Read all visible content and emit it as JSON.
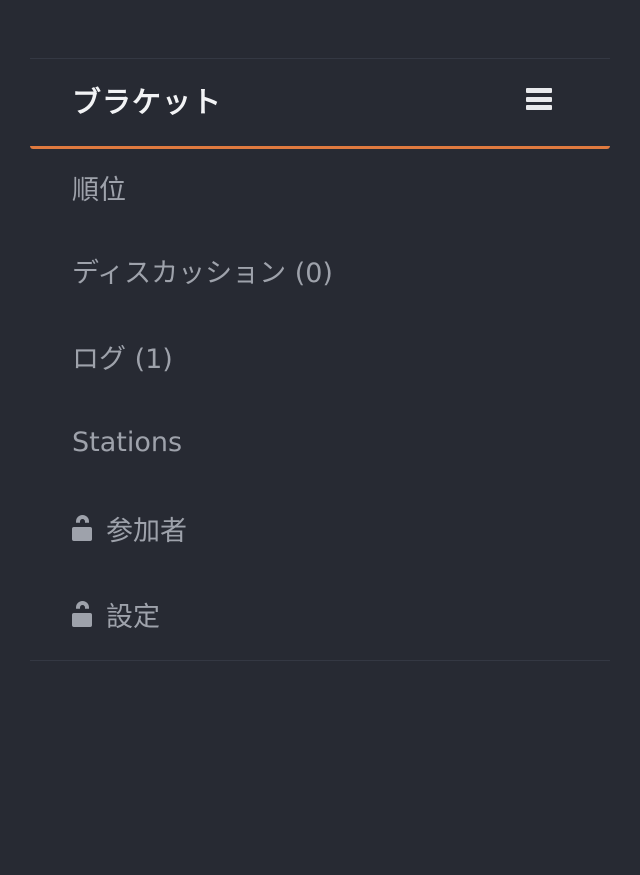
{
  "header": {
    "title": "ブラケット",
    "menu_icon": "hamburger-menu-icon"
  },
  "nav": {
    "items": [
      {
        "label": "順位",
        "locked": false
      },
      {
        "label": "ディスカッション (0)",
        "locked": false
      },
      {
        "label": "ログ (1)",
        "locked": false
      },
      {
        "label": "Stations",
        "locked": false
      },
      {
        "label": "参加者",
        "locked": true,
        "icon": "unlock-icon"
      },
      {
        "label": "設定",
        "locked": true,
        "icon": "unlock-icon"
      }
    ]
  },
  "colors": {
    "background": "#272a33",
    "accent": "#e07a3f",
    "title_text": "#f2f3f5",
    "item_text": "#9ea2ab",
    "divider": "#343843"
  }
}
